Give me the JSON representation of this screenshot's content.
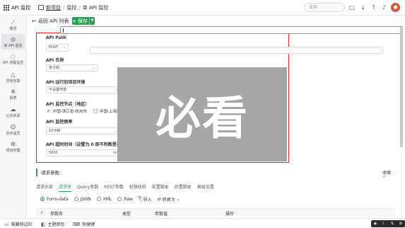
{
  "app": {
    "title": "API 监控"
  },
  "breadcrumb": {
    "items": [
      "新项目",
      "监控",
      "单 API 监控"
    ],
    "sep": "/"
  },
  "topbar": {
    "search_placeholder": "搜索",
    "avatar_letter": "●"
  },
  "sidebar": {
    "items": [
      {
        "label": "概览",
        "icon": "chart-icon"
      },
      {
        "label": "单 API 监控",
        "icon": "globe-icon",
        "active": true
      },
      {
        "label": "API 流程监控",
        "icon": "flow-icon"
      },
      {
        "label": "异常告警",
        "icon": "warning-icon"
      },
      {
        "label": "报表",
        "icon": "report-icon"
      },
      {
        "label": "公共资源",
        "icon": "cloud-icon"
      },
      {
        "label": "协作成员",
        "icon": "members-icon"
      },
      {
        "label": "项目管理",
        "icon": "settings-icon"
      }
    ]
  },
  "toolbar": {
    "back_label": "返回 API 列表",
    "save_label": "保存"
  },
  "form": {
    "api_path_label": "API Path",
    "method": "POST",
    "api_name_label": "API 名称",
    "group_value": "未分组",
    "env_label": "API 运行的项目环境",
    "env_value": "不设置环境",
    "node_label": "API 监控节点（地区）",
    "node_options": [
      {
        "label": "中国-浙江省-杭州市",
        "checked": true
      },
      {
        "label": "中国-上海市",
        "checked": false
      }
    ],
    "freq_label": "API 监控频率",
    "freq_value": "10分钟",
    "timeout_label": "API 超时时间（设置为 0 即不判断是否超时，最",
    "timeout_value": "5000",
    "timeout_unit": "ms"
  },
  "overlay": {
    "text": "必看"
  },
  "request": {
    "section_title": "请求参数",
    "collapse_label": "收缩",
    "tabs": [
      "请求头部",
      "请求体",
      "Query参数",
      "REST参数",
      "权限校验",
      "前置脚本",
      "后置脚本",
      "高级设置"
    ],
    "active_tab": 1,
    "body_types": [
      "Form-data",
      "JSON",
      "XML",
      "Raw"
    ],
    "active_body_type": 0,
    "import_label": "导入",
    "convert_label": "转换为",
    "table_headers": [
      "参数名",
      "类型",
      "参数值",
      "操作"
    ]
  },
  "bottombar": {
    "hide_sidebar": "隐藏侧边栏",
    "theme": "主题颜色",
    "shortcuts": "快捷键"
  }
}
